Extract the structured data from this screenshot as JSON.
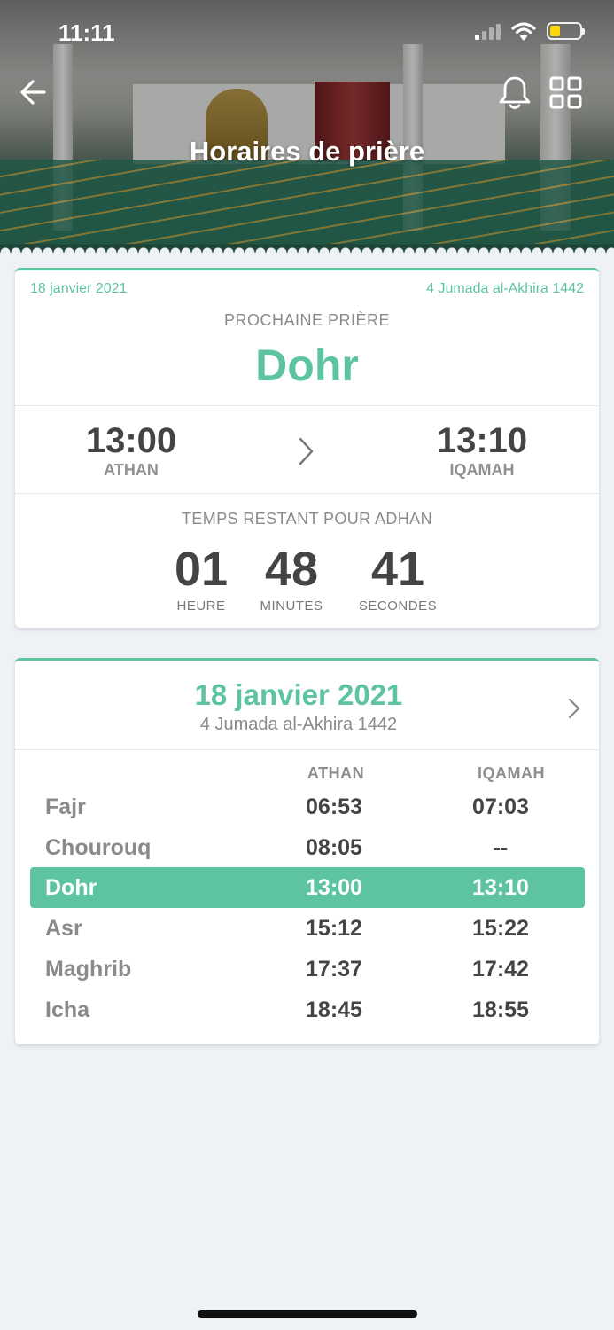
{
  "status_bar": {
    "time": "11:11"
  },
  "header": {
    "title": "Horaires de prière"
  },
  "next_prayer": {
    "gregorian_date": "18 janvier 2021",
    "hijri_date": "4 Jumada al-Akhira 1442",
    "label": "PROCHAINE PRIÈRE",
    "name": "Dohr",
    "athan_time": "13:00",
    "athan_label": "ATHAN",
    "iqamah_time": "13:10",
    "iqamah_label": "IQAMAH",
    "remaining_label": "TEMPS RESTANT POUR ADHAN",
    "hours": "01",
    "hours_label": "HEURE",
    "minutes": "48",
    "minutes_label": "MINUTES",
    "seconds": "41",
    "seconds_label": "SECONDES"
  },
  "schedule": {
    "gregorian_date": "18 janvier 2021",
    "hijri_date": "4 Jumada al-Akhira 1442",
    "col_athan": "ATHAN",
    "col_iqamah": "IQAMAH",
    "rows": [
      {
        "name": "Fajr",
        "athan": "06:53",
        "iqamah": "07:03"
      },
      {
        "name": "Chourouq",
        "athan": "08:05",
        "iqamah": "--"
      },
      {
        "name": "Dohr",
        "athan": "13:00",
        "iqamah": "13:10"
      },
      {
        "name": "Asr",
        "athan": "15:12",
        "iqamah": "15:22"
      },
      {
        "name": "Maghrib",
        "athan": "17:37",
        "iqamah": "17:42"
      },
      {
        "name": "Icha",
        "athan": "18:45",
        "iqamah": "18:55"
      }
    ],
    "active_row": "Dohr"
  },
  "colors": {
    "accent": "#5ec4a0",
    "background": "#eef1f6"
  }
}
